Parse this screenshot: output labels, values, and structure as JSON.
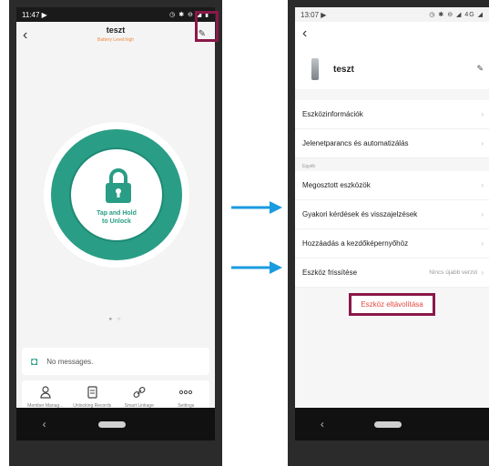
{
  "left": {
    "status_time": "11:47",
    "status_left_icon": "▶",
    "status_icons": "◷ ✱ ⊖ ◢ ▮",
    "title": "teszt",
    "subtitle": "Battery Level:high",
    "unlock_text": "Tap and Hold\nto Unlock",
    "pager": "● ○",
    "messages": "No messages.",
    "tools": [
      {
        "label": "Member Manag...",
        "icon": "person-icon"
      },
      {
        "label": "Unlocking Records",
        "icon": "document-icon"
      },
      {
        "label": "Smart Linkage",
        "icon": "link-icon"
      },
      {
        "label": "Settings",
        "icon": "more-icon"
      }
    ]
  },
  "right": {
    "status_time": "13:07",
    "status_left_icon": "▶",
    "status_icons": "◷ ✱ ⊖ ◢ 4G ◢",
    "device_name": "teszt",
    "menu_top": [
      {
        "label": "Eszközinformációk"
      },
      {
        "label": "Jelenetparancs és automatizálás"
      }
    ],
    "section_label": "Egyéb",
    "menu_bottom": [
      {
        "label": "Megosztott eszközök",
        "value": ""
      },
      {
        "label": "Gyakori kérdések és visszajelzések",
        "value": ""
      },
      {
        "label": "Hozzáadás a kezdőképernyőhöz",
        "value": ""
      },
      {
        "label": "Eszköz frissítése",
        "value": "Nincs újabb verzió"
      }
    ],
    "remove_label": "Eszköz eltávolítása"
  },
  "colors": {
    "teal": "#2a9d86",
    "highlight": "#8a1848",
    "arrow": "#1a9be0",
    "danger": "#e4483f"
  }
}
